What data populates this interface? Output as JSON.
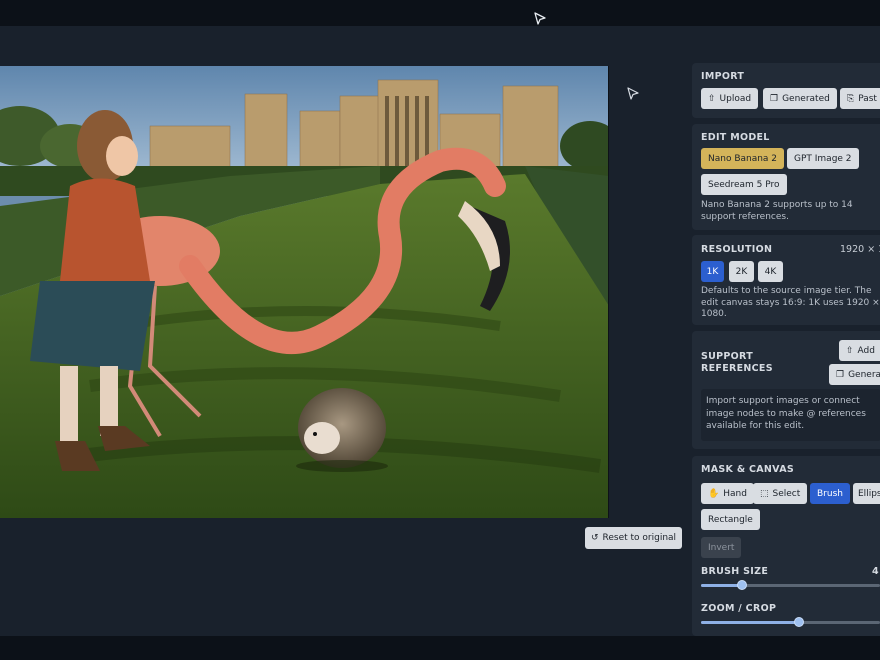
{
  "import": {
    "title": "IMPORT",
    "upload_label": "Upload",
    "generated_label": "Generated",
    "paste_label": "Past"
  },
  "edit_model": {
    "title": "EDIT MODEL",
    "options": [
      "Nano Banana 2",
      "GPT Image 2",
      "Seedream 5 Pro"
    ],
    "selected": "Nano Banana 2",
    "description": "Nano Banana 2 supports up to 14 support references."
  },
  "resolution": {
    "title": "RESOLUTION",
    "value": "1920 × 1",
    "options": [
      "1K",
      "2K",
      "4K"
    ],
    "selected": "1K",
    "description": "Defaults to the source image tier. The edit canvas stays 16:9: 1K uses 1920 × 1080."
  },
  "support_references": {
    "title_line1": "SUPPORT",
    "title_line2": "REFERENCES",
    "add_label": "Add",
    "generate_label": "Genera",
    "info": "Import support images or connect image nodes to make @ references available for this edit."
  },
  "mask_canvas": {
    "title": "MASK & CANVAS",
    "tools": [
      "Hand",
      "Select",
      "Brush",
      "Ellips"
    ],
    "selected": "Brush",
    "rectangle_label": "Rectangle",
    "invert_label": "Invert"
  },
  "brush_size": {
    "title": "BRUSH SIZE",
    "value": "4",
    "level": 0.23
  },
  "zoom_crop": {
    "title": "ZOOM / CROP",
    "level": 0.55
  },
  "canvas": {
    "reset_label": "Reset to original"
  },
  "colors": {
    "accent_blue": "#2c5fcf",
    "accent_gold": "#d4b45a",
    "panel_bg": "#222b37",
    "app_bg": "#19212c"
  }
}
